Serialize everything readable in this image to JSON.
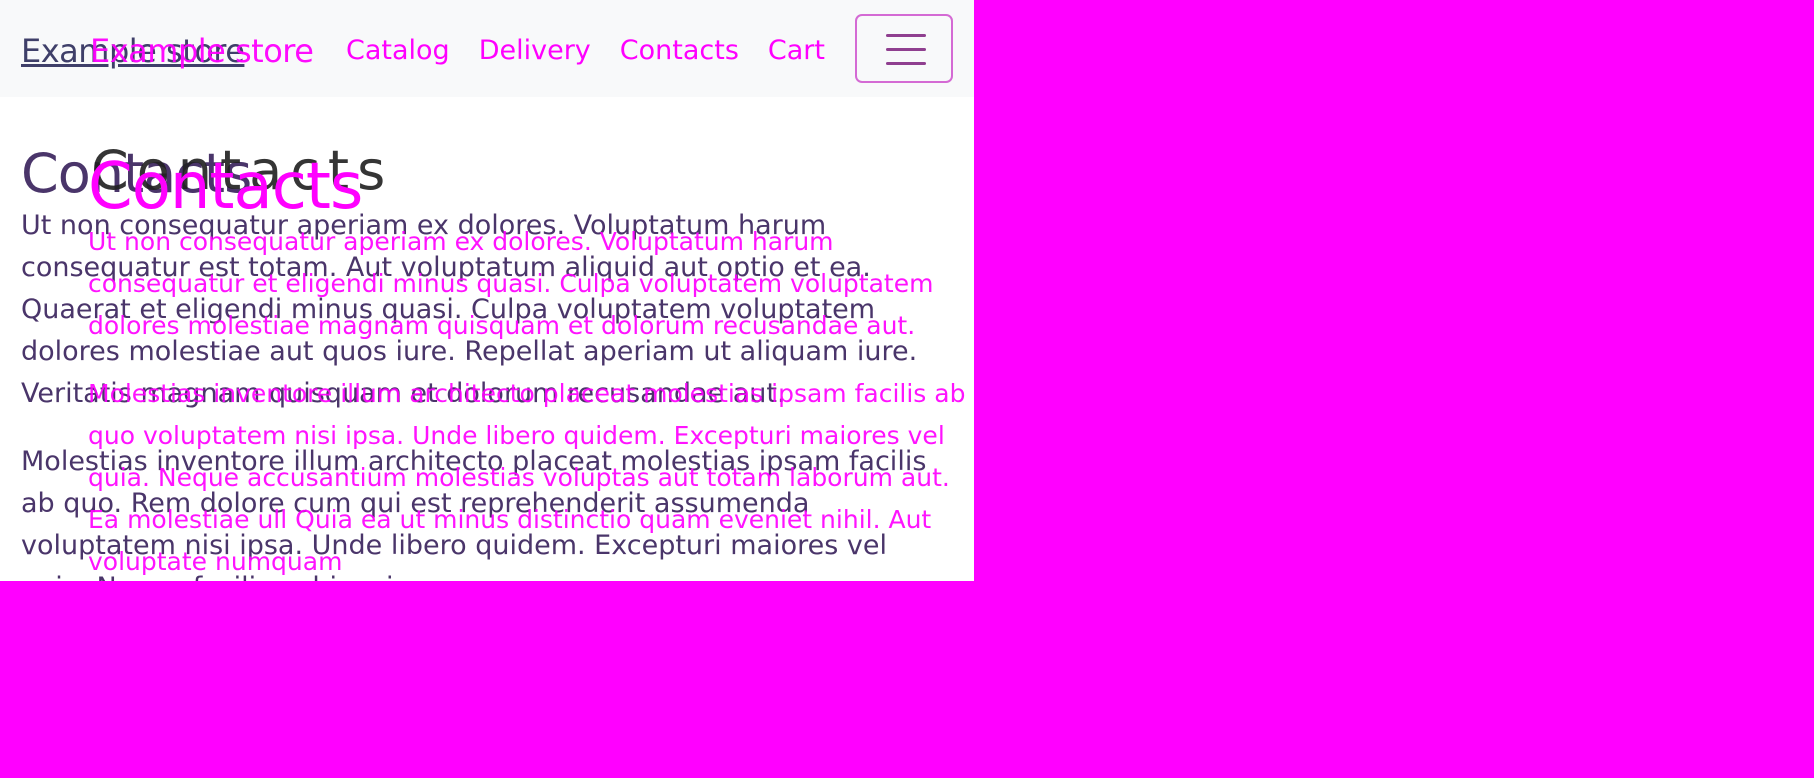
{
  "page": {
    "brand": "Example store",
    "nav_links": [
      "Catalog",
      "Delivery",
      "Contacts",
      "Cart"
    ],
    "toggle_icon": "menu-icon",
    "title": "Contacts",
    "paragraphs": [
      "Ut non consequatur aperiam ex dolores. Voluptatum harum consequatur est totam. Aut voluptatum aliquid aut optio et ea. Quaerat et eligendi minus quasi. Culpa voluptatem voluptatem dolores molestiae aut quos iure. Repellat aperiam ut aliquam iure. Veritatis magnam quisquam et dolorum recusandae aut.",
      "Molestias inventore illum architecto placeat molestias ipsam facilis ab quo. Rem dolore cum qui est reprehenderit assumenda voluptatem nisi ipsa. Unde libero quidem. Excepturi maiores vel quia. Neque facilis nobis minus"
    ]
  },
  "overlay": {
    "brand": "Example store",
    "title": "Contacts",
    "paragraphs": [
      "Ut non consequatur aperiam ex dolores. Voluptatum harum consequatur et eligendi minus quasi. Culpa voluptatem voluptatem dolores molestiae magnam quisquam et dolorum recusandae aut.",
      "Molestias inventore illum architecto placeat molestias ipsam facilis ab quo voluptatem nisi ipsa. Unde libero quidem. Excepturi maiores vel quia. Neque accusantium molestias voluptas aut totam laborum aut. Ea molestiae ull Quia ea ut minus distinctio quam eveniet nihil. Aut voluptate numquam"
    ]
  },
  "colors": {
    "background": "#ff00ff",
    "viewport": "#ffffff",
    "navbar": "#f8f9fa",
    "base_text": "#4a356a",
    "overlay_text": "#ff00ff",
    "toggler_border": "#d46ad4"
  }
}
